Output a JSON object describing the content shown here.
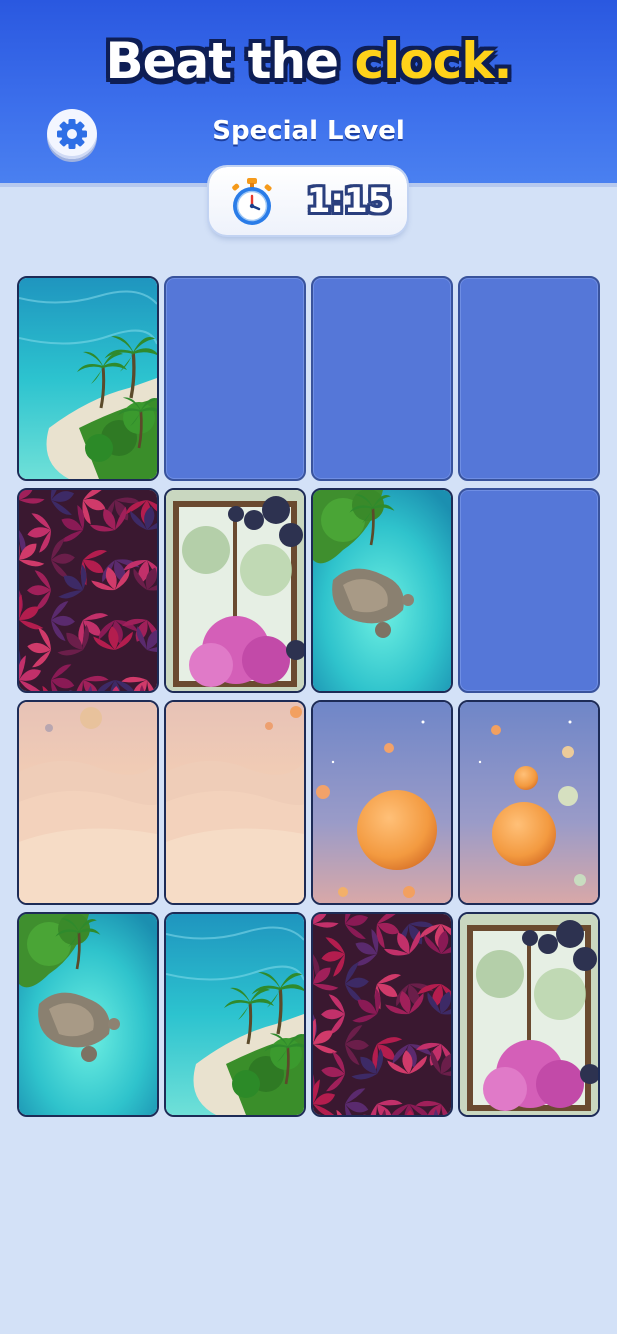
{
  "header": {
    "headline_part1": "Beat the",
    "headline_part2": "clock.",
    "level_title": "Special Level"
  },
  "settings": {
    "icon": "gear-icon"
  },
  "timer": {
    "icon": "stopwatch-icon",
    "value": "1:15"
  },
  "board": {
    "rows": 4,
    "cols": 4,
    "tiles": [
      {
        "state": "revealed",
        "image": "tropical-island"
      },
      {
        "state": "hidden",
        "image": ""
      },
      {
        "state": "hidden",
        "image": ""
      },
      {
        "state": "hidden",
        "image": ""
      },
      {
        "state": "revealed",
        "image": "red-vine-leaves"
      },
      {
        "state": "revealed",
        "image": "window-garden"
      },
      {
        "state": "revealed",
        "image": "rocky-lagoon"
      },
      {
        "state": "hidden",
        "image": ""
      },
      {
        "state": "revealed",
        "image": "pastel-desert"
      },
      {
        "state": "revealed",
        "image": "pastel-desert"
      },
      {
        "state": "revealed",
        "image": "orange-planets"
      },
      {
        "state": "revealed",
        "image": "orange-planets"
      },
      {
        "state": "revealed",
        "image": "rocky-lagoon"
      },
      {
        "state": "revealed",
        "image": "tropical-island"
      },
      {
        "state": "revealed",
        "image": "red-vine-leaves"
      },
      {
        "state": "revealed",
        "image": "window-garden"
      }
    ]
  },
  "colors": {
    "header_blue": "#2a58e0",
    "tile_hidden": "#5577d8",
    "background": "#d3e1f7",
    "accent_yellow": "#ffd21a"
  }
}
